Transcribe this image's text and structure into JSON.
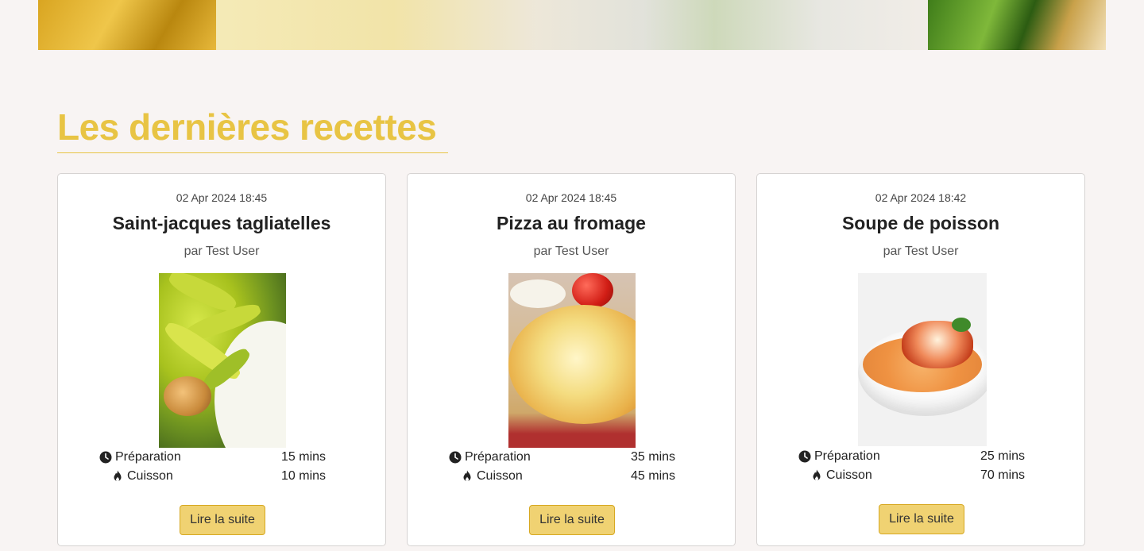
{
  "section": {
    "title": "Les dernières recettes"
  },
  "labels": {
    "prep": "Préparation",
    "cook": "Cuisson",
    "read_more": "Lire la suite"
  },
  "recipes": [
    {
      "date": "02 Apr 2024 18:45",
      "title": "Saint-jacques tagliatelles",
      "author": "par Test User",
      "prep_time": "15 mins",
      "cook_time": "10 mins",
      "image": "tagliatelle-scallop-photo"
    },
    {
      "date": "02 Apr 2024 18:45",
      "title": "Pizza au fromage",
      "author": "par Test User",
      "prep_time": "35 mins",
      "cook_time": "45 mins",
      "image": "cheese-pizza-photo"
    },
    {
      "date": "02 Apr 2024 18:42",
      "title": "Soupe de poisson",
      "author": "par Test User",
      "prep_time": "25 mins",
      "cook_time": "70 mins",
      "image": "fish-soup-photo"
    }
  ],
  "icons": {
    "prep": "clock-icon",
    "cook": "flame-icon"
  },
  "colors": {
    "accent": "#e8c444",
    "button": "#f0d272",
    "button_border": "#d7a821",
    "background": "#f8f4f3"
  }
}
